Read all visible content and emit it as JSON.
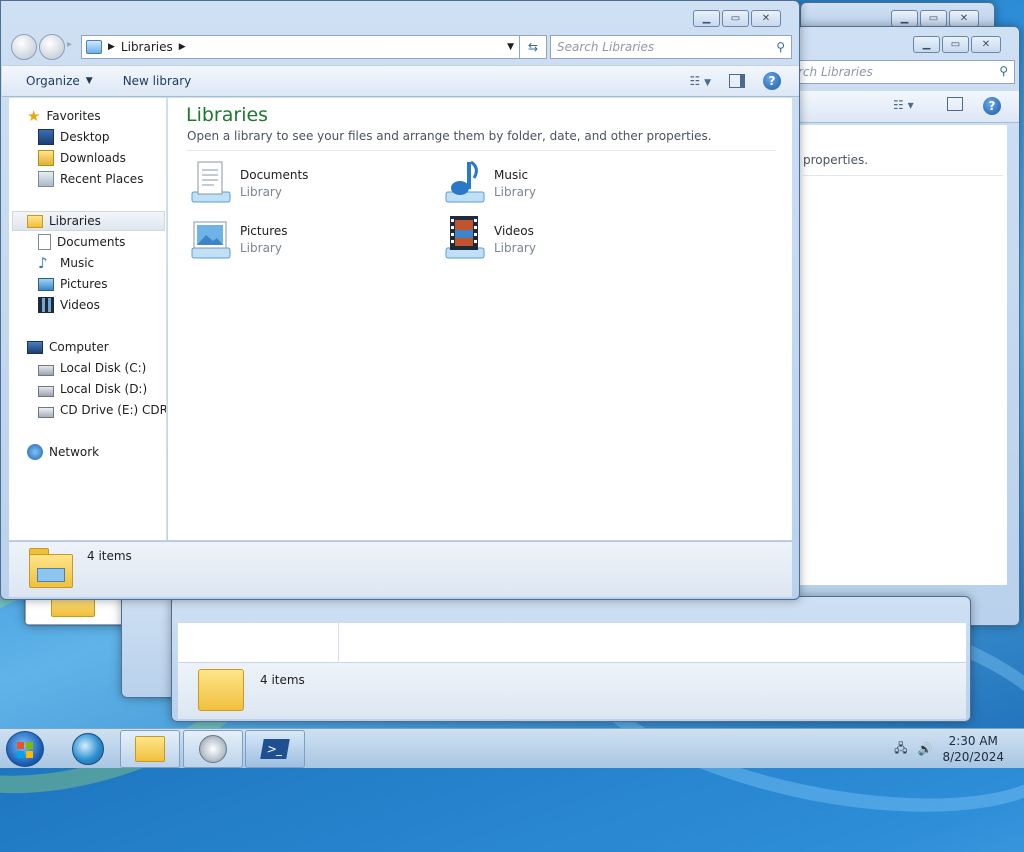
{
  "main_window": {
    "address": {
      "segments": [
        "Libraries"
      ]
    },
    "search": {
      "placeholder": "Search Libraries"
    },
    "toolbar": {
      "organize": "Organize",
      "new_library": "New library"
    },
    "nav": {
      "favorites": "Favorites",
      "desktop": "Desktop",
      "downloads": "Downloads",
      "recent_places": "Recent Places",
      "libraries": "Libraries",
      "documents": "Documents",
      "music": "Music",
      "pictures": "Pictures",
      "videos": "Videos",
      "computer": "Computer",
      "local_disk_c": "Local Disk (C:)",
      "local_disk_d": "Local Disk (D:)",
      "cd_drive": "CD Drive (E:) CDROM",
      "network": "Network"
    },
    "content": {
      "title": "Libraries",
      "subtitle": "Open a library to see your files and arrange them by folder, date, and other properties.",
      "libraries": [
        {
          "name": "Documents",
          "kind": "Library"
        },
        {
          "name": "Music",
          "kind": "Library"
        },
        {
          "name": "Pictures",
          "kind": "Library"
        },
        {
          "name": "Videos",
          "kind": "Library"
        }
      ]
    },
    "details": {
      "items": "4 items"
    }
  },
  "back_window": {
    "search_fragment": "rch Libraries",
    "properties_fragment": "properties.",
    "items": "4 items"
  },
  "taskbar": {
    "time": "2:30 AM",
    "date": "8/20/2024"
  },
  "colors": {
    "title_green": "#1c7a2c",
    "chrome_blue": "#b9d1ec",
    "desktop_blue": "#1f76c0"
  }
}
